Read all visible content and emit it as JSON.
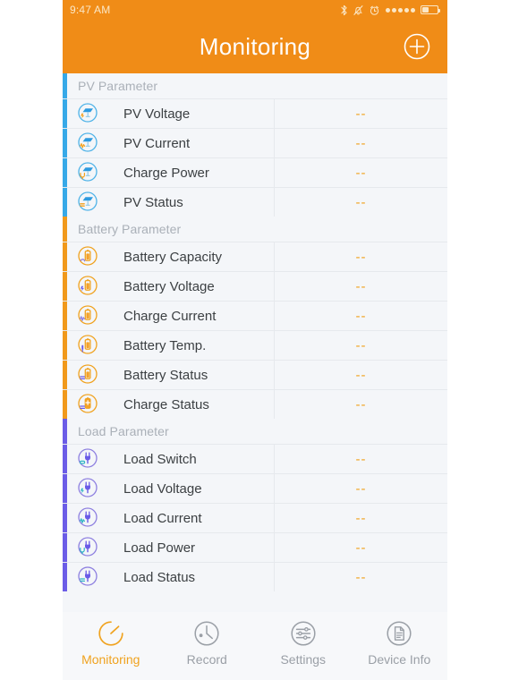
{
  "status_bar": {
    "time": "9:47 AM",
    "icons": [
      "bluetooth-icon",
      "bell-muted-icon",
      "alarm-clock-icon",
      "signal-dots-icon",
      "battery-icon"
    ],
    "signal_dots": 5,
    "battery_level_pct": 45
  },
  "header": {
    "title": "Monitoring",
    "add_button": "add-circle-icon",
    "background_color": "#F08C17",
    "title_color": "#FFFFFF"
  },
  "colors": {
    "pv_accent": "#36A9E8",
    "battery_accent": "#F1991B",
    "load_accent": "#6B5CE7",
    "value_text": "#F0A21E",
    "label_text": "#3C4043",
    "section_header_text": "#AAB0B8",
    "list_background": "#F4F6F9"
  },
  "sections": [
    {
      "id": "pv",
      "header": "PV Parameter",
      "accent": "#36A9E8",
      "rows": [
        {
          "icon": "pv-voltage-icon",
          "label": "PV Voltage",
          "value": "--"
        },
        {
          "icon": "pv-current-icon",
          "label": "PV Current",
          "value": "--"
        },
        {
          "icon": "pv-charge-power-icon",
          "label": "Charge Power",
          "value": "--"
        },
        {
          "icon": "pv-status-icon",
          "label": "PV Status",
          "value": "--"
        }
      ]
    },
    {
      "id": "battery",
      "header": "Battery Parameter",
      "accent": "#F1991B",
      "rows": [
        {
          "icon": "battery-capacity-icon",
          "label": "Battery Capacity",
          "value": "--",
          "clipped": true
        },
        {
          "icon": "battery-voltage-icon",
          "label": "Battery Voltage",
          "value": "--"
        },
        {
          "icon": "battery-charge-current-icon",
          "label": "Charge Current",
          "value": "--"
        },
        {
          "icon": "battery-temperature-icon",
          "label": "Battery Temp.",
          "value": "--"
        },
        {
          "icon": "battery-status-icon",
          "label": "Battery Status",
          "value": "--"
        },
        {
          "icon": "battery-charge-status-icon",
          "label": "Charge Status",
          "value": "--"
        }
      ]
    },
    {
      "id": "load",
      "header": "Load Parameter",
      "accent": "#6B5CE7",
      "rows": [
        {
          "icon": "load-switch-icon",
          "label": "Load Switch",
          "value": "--"
        },
        {
          "icon": "load-voltage-icon",
          "label": "Load Voltage",
          "value": "--"
        },
        {
          "icon": "load-current-icon",
          "label": "Load Current",
          "value": "--"
        },
        {
          "icon": "load-power-icon",
          "label": "Load Power",
          "value": "--"
        },
        {
          "icon": "load-status-icon",
          "label": "Load Status",
          "value": "--"
        }
      ]
    }
  ],
  "tabbar": {
    "items": [
      {
        "icon": "gauge-icon",
        "label": "Monitoring",
        "active": true
      },
      {
        "icon": "clock-icon",
        "label": "Record",
        "active": false
      },
      {
        "icon": "sliders-icon",
        "label": "Settings",
        "active": false
      },
      {
        "icon": "document-icon",
        "label": "Device Info",
        "active": false
      }
    ]
  }
}
